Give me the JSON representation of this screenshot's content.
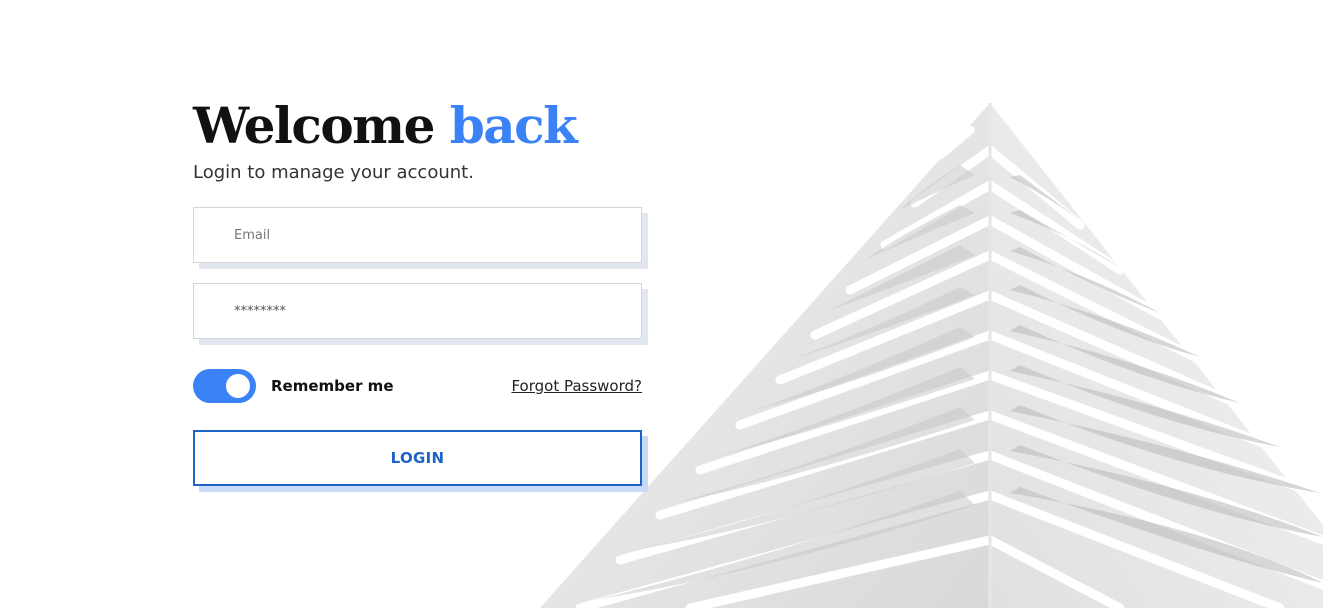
{
  "header": {
    "title_main": "Welcome",
    "title_accent": "back",
    "subtitle": "Login to manage your account."
  },
  "form": {
    "email_placeholder": "Email",
    "password_value": "********",
    "remember_label": "Remember me",
    "remember_checked": true,
    "forgot_label": "Forgot Password?",
    "login_label": "LOGIN"
  },
  "colors": {
    "accent": "#3b82f6",
    "button_border": "#1e64c8",
    "button_shadow": "#c7daf7"
  },
  "decor": {
    "image_subject": "building-icon"
  }
}
